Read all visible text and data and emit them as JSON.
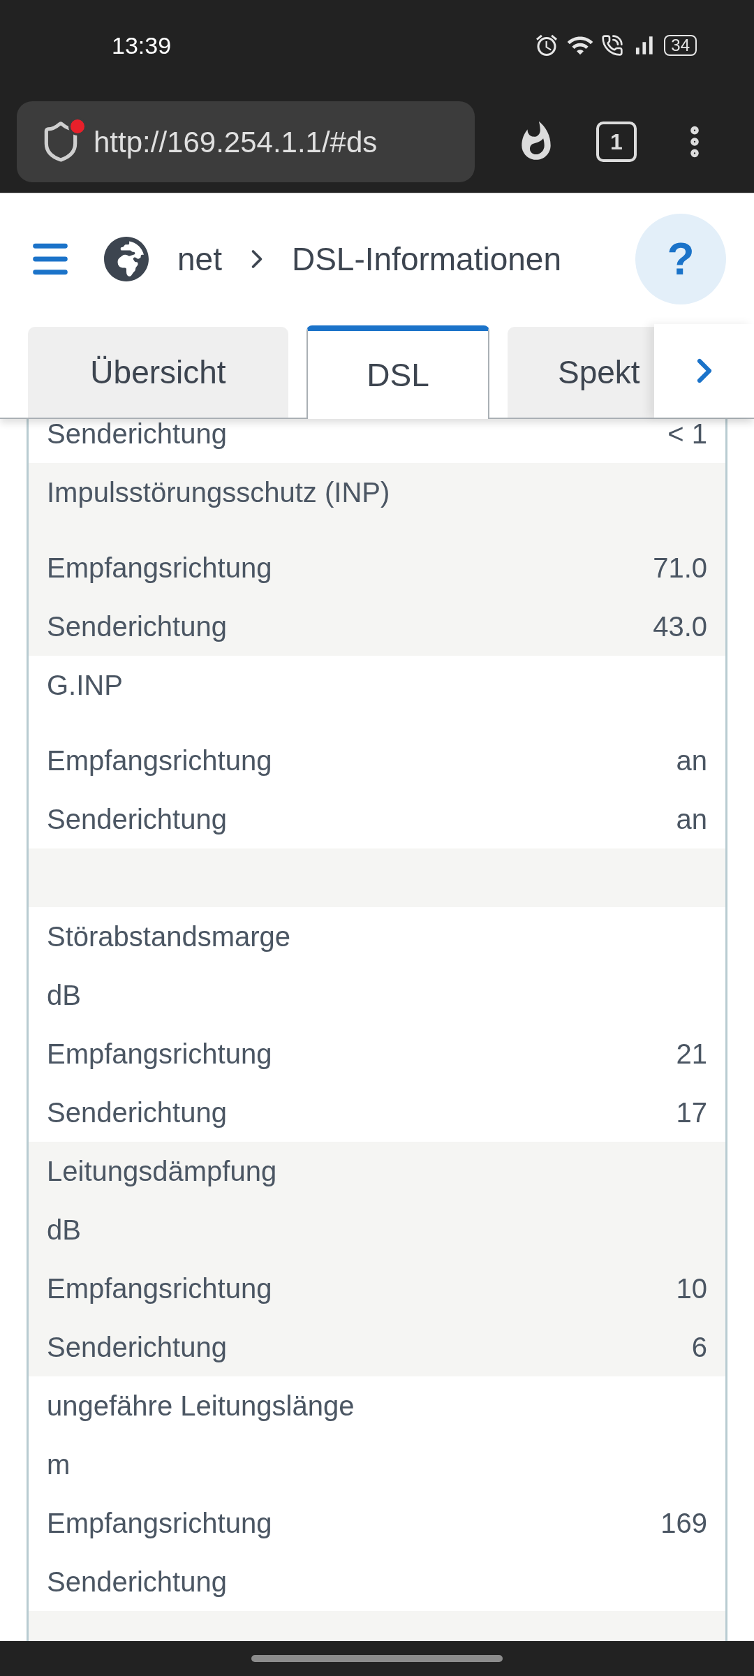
{
  "status_bar": {
    "time": "13:39",
    "battery": "34"
  },
  "browser": {
    "url": "http://169.254.1.1/#ds",
    "tab_count": "1"
  },
  "header": {
    "breadcrumb": [
      "net",
      "DSL-Informationen"
    ],
    "help": "?"
  },
  "tabs": [
    {
      "label": "Übersicht",
      "selected": false
    },
    {
      "label": "DSL",
      "selected": true
    },
    {
      "label": "Spekt",
      "selected": false
    }
  ],
  "groups": [
    {
      "kind": "section",
      "rows": [
        {
          "label": "Senderichtung",
          "value": "< 1"
        }
      ]
    },
    {
      "kind": "section",
      "title": "Impulsstörungsschutz (INP)",
      "rows": [
        {
          "label": "Empfangsrichtung",
          "value": "71.0"
        },
        {
          "label": "Senderichtung",
          "value": "43.0"
        }
      ]
    },
    {
      "kind": "section",
      "title": "G.INP",
      "rows": [
        {
          "label": "Empfangsrichtung",
          "value": "an"
        },
        {
          "label": "Senderichtung",
          "value": "an"
        }
      ]
    },
    {
      "kind": "spacer"
    },
    {
      "kind": "section",
      "title": "Störabstandsmarge",
      "unit": "dB",
      "rows": [
        {
          "label": "Empfangsrichtung",
          "value": "21"
        },
        {
          "label": "Senderichtung",
          "value": "17"
        }
      ]
    },
    {
      "kind": "section",
      "title": "Leitungsdämpfung",
      "unit": "dB",
      "rows": [
        {
          "label": "Empfangsrichtung",
          "value": "10"
        },
        {
          "label": "Senderichtung",
          "value": "6"
        }
      ]
    },
    {
      "kind": "section",
      "title": "ungefähre Leitungslänge",
      "unit": "m",
      "rows": [
        {
          "label": "Empfangsrichtung",
          "value": "169"
        },
        {
          "label": "Senderichtung"
        }
      ]
    },
    {
      "kind": "spacer"
    }
  ]
}
